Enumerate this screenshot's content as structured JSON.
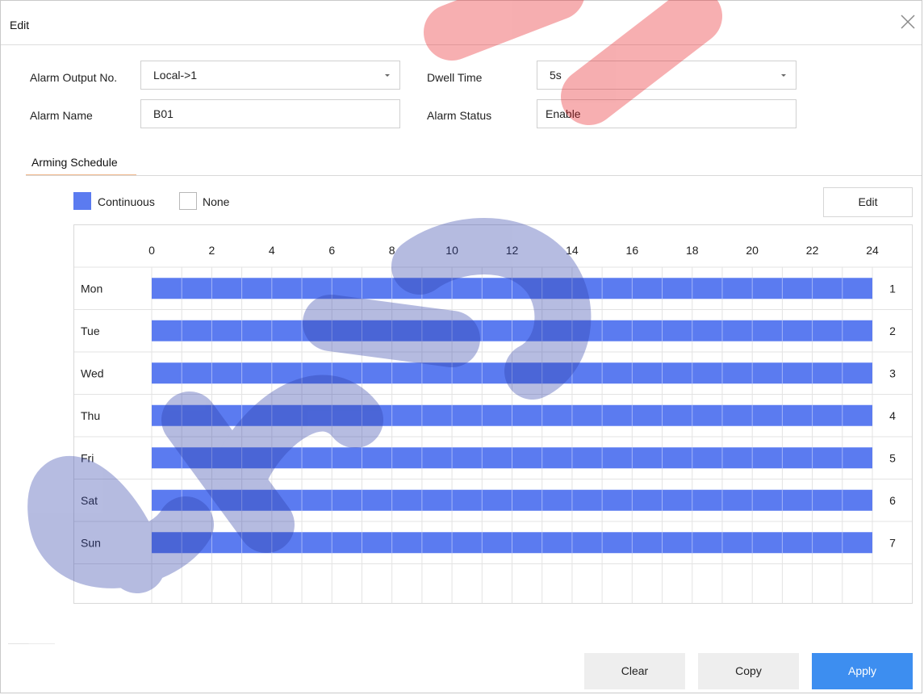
{
  "dialog": {
    "title": "Edit"
  },
  "form": {
    "alarm_output_label": "Alarm Output No.",
    "alarm_output_value": "Local->1",
    "dwell_time_label": "Dwell Time",
    "dwell_time_value": "5s",
    "alarm_name_label": "Alarm Name",
    "alarm_name_value": "B01",
    "alarm_status_label": "Alarm Status",
    "alarm_status_value": "Enable"
  },
  "tab": {
    "label": "Arming Schedule"
  },
  "legend": {
    "continuous_label": "Continuous",
    "continuous_color": "#5b7bf0",
    "none_label": "None"
  },
  "schedule": {
    "edit_label": "Edit",
    "hour_ticks": [
      "0",
      "2",
      "4",
      "6",
      "8",
      "10",
      "12",
      "14",
      "16",
      "18",
      "20",
      "22",
      "24"
    ],
    "days": [
      {
        "name": "Mon",
        "index": "1",
        "start": 0,
        "end": 24
      },
      {
        "name": "Tue",
        "index": "2",
        "start": 0,
        "end": 24
      },
      {
        "name": "Wed",
        "index": "3",
        "start": 0,
        "end": 24
      },
      {
        "name": "Thu",
        "index": "4",
        "start": 0,
        "end": 24
      },
      {
        "name": "Fri",
        "index": "5",
        "start": 0,
        "end": 24
      },
      {
        "name": "Sat",
        "index": "6",
        "start": 0,
        "end": 24
      },
      {
        "name": "Sun",
        "index": "7",
        "start": 0,
        "end": 24
      }
    ]
  },
  "footer": {
    "clear_label": "Clear",
    "copy_label": "Copy",
    "apply_label": "Apply",
    "apply_color": "#3d8ef0"
  },
  "watermark": {
    "text": "StothisN",
    "color": "#e8191f"
  }
}
